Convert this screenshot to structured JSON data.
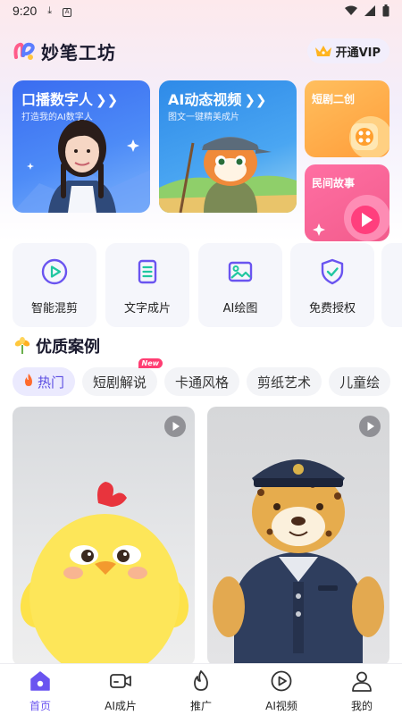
{
  "status_bar": {
    "time": "9:20"
  },
  "header": {
    "app_title": "妙笔工坊",
    "vip_label": "开通VIP"
  },
  "cards": {
    "digital_human": {
      "title": "口播数字人",
      "subtitle": "打造我的AI数字人"
    },
    "ai_video": {
      "title": "AI动态视频",
      "subtitle": "图文一键精美成片"
    },
    "short_drama": {
      "title": "短剧二创"
    },
    "folk_story": {
      "title": "民间故事"
    }
  },
  "tools": [
    {
      "label": "智能混剪",
      "icon": "play-circle-icon"
    },
    {
      "label": "文字成片",
      "icon": "document-icon"
    },
    {
      "label": "AI绘图",
      "icon": "image-icon"
    },
    {
      "label": "免费授权",
      "icon": "shield-check-icon"
    }
  ],
  "section": {
    "title": "优质案例"
  },
  "categories": [
    {
      "label": "热门",
      "active": true
    },
    {
      "label": "短剧解说",
      "badge": "New"
    },
    {
      "label": "卡通风格"
    },
    {
      "label": "剪纸艺术"
    },
    {
      "label": "儿童绘"
    }
  ],
  "nav": [
    {
      "label": "首页",
      "icon": "home-icon",
      "active": true
    },
    {
      "label": "AI成片",
      "icon": "video-camera-icon"
    },
    {
      "label": "推广",
      "icon": "flame-icon"
    },
    {
      "label": "AI视频",
      "icon": "play-circle-icon"
    },
    {
      "label": "我的",
      "icon": "user-icon"
    }
  ],
  "colors": {
    "accent": "#6a54f0",
    "digital_card": "#3a6cf0",
    "video_card": "#2e8ae8",
    "drama_card": "#ffa53f",
    "folk_card": "#f5618f"
  }
}
